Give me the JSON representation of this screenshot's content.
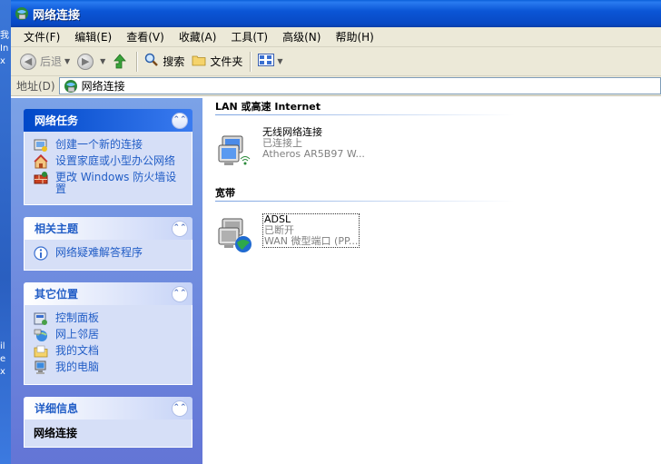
{
  "desktop": {
    "edge_text": [
      "我",
      "In",
      "x",
      "il",
      "e",
      "x"
    ]
  },
  "window": {
    "title": "网络连接"
  },
  "menu": [
    "文件(F)",
    "编辑(E)",
    "查看(V)",
    "收藏(A)",
    "工具(T)",
    "高级(N)",
    "帮助(H)"
  ],
  "toolbar": {
    "back": "后退",
    "search": "搜索",
    "folders": "文件夹"
  },
  "address": {
    "label": "地址(D)",
    "value": "网络连接"
  },
  "taskpane": {
    "network_tasks": {
      "title": "网络任务",
      "items": [
        "创建一个新的连接",
        "设置家庭或小型办公网络",
        "更改 Windows 防火墙设置"
      ]
    },
    "see_also": {
      "title": "相关主题",
      "items": [
        "网络疑难解答程序"
      ]
    },
    "other_places": {
      "title": "其它位置",
      "items": [
        "控制面板",
        "网上邻居",
        "我的文档",
        "我的电脑"
      ]
    },
    "details": {
      "title": "详细信息",
      "first_line": "网络连接"
    }
  },
  "content": {
    "groups": [
      {
        "header": "LAN 或高速 Internet",
        "connections": [
          {
            "name": "无线网络连接",
            "status": "已连接上",
            "device": "Atheros AR5B97 W..."
          }
        ]
      },
      {
        "header": "宽带",
        "connections": [
          {
            "name": "ADSL",
            "status": "已断开",
            "device": "WAN 微型端口 (PP..."
          }
        ]
      }
    ]
  },
  "colors": {
    "titlebar": "#0848c4",
    "taskpane_bg": "#6f8fe0",
    "link": "#215dc6",
    "chrome": "#ece9d8"
  }
}
